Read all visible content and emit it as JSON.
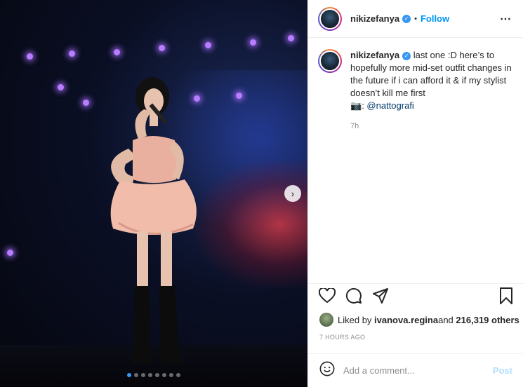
{
  "post": {
    "username": "nikizefanya",
    "separator": "•",
    "follow_label": "Follow",
    "more_icon": "⋯",
    "caption_username": "nikizefanya",
    "caption_text": " last one :D here’s to hopefully more mid-set outfit changes in the future if i can afford it & if my stylist doesn’t kill me first",
    "camera_emoji": "📷",
    "credit_prefix": ": ",
    "credit_mention": "@nattografi",
    "caption_age": "7h",
    "liked_by_prefix": "Liked by ",
    "liked_by_user": "ivanova.regina",
    "liked_by_middle": " and ",
    "likes_count": "216,319 others",
    "posted_time": "7 HOURS AGO"
  },
  "comment_box": {
    "placeholder": "Add a comment...",
    "post_label": "Post"
  },
  "carousel": {
    "next_label": "›",
    "slide_count": 8,
    "active_slide": 0
  },
  "icons": {
    "header_avatar": "profile-avatar-icon",
    "verified": "verified-badge-icon",
    "like": "heart-icon",
    "comment": "comment-icon",
    "share": "share-icon",
    "save": "bookmark-icon",
    "emoji": "smiley-icon"
  },
  "colors": {
    "link_blue": "#0095f6",
    "post_disabled": "#b2dffc",
    "verified_blue": "#3897f0",
    "muted": "#8e8e8e"
  }
}
